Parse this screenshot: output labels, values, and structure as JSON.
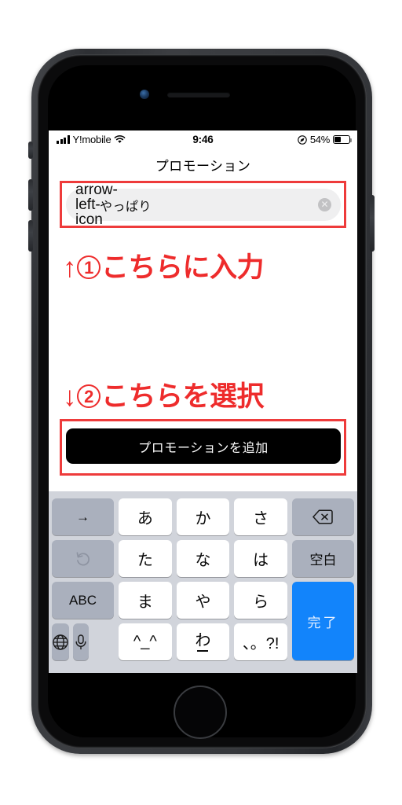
{
  "device": {
    "name": "iphone-se-black",
    "earpiece": "speaker-slot",
    "camera": "front-camera",
    "home_button": "home-button"
  },
  "status_bar": {
    "carrier": "Y!mobile",
    "signal_icon": "signal-bars-icon",
    "wifi_icon": "wifi-icon",
    "time": "9:46",
    "location_icon": "location-arrow-icon",
    "battery_percent": "54%",
    "battery_level": 54,
    "battery_icon": "battery-icon"
  },
  "nav": {
    "title": "プロモーション"
  },
  "search": {
    "back_icon": "arrow-left-icon",
    "value": "やっぱり",
    "clear_icon": "clear-circle-icon"
  },
  "annotations": [
    {
      "arrow": "↑",
      "number": "1",
      "text": "こちらに入力",
      "color": "#ee2c2c"
    },
    {
      "arrow": "↓",
      "number": "2",
      "text": "こちらを選択",
      "color": "#ee2c2c"
    }
  ],
  "cta": {
    "label": "プロモーションを追加",
    "background": "#000000",
    "text_color": "#ffffff"
  },
  "keyboard": {
    "type": "japanese-kana-12key",
    "background": "#d1d4db",
    "keys": {
      "arrow_right": "→",
      "undo": "↺",
      "abc": "ABC",
      "globe": "globe-icon",
      "mic": "microphone-icon",
      "a": "あ",
      "ka": "か",
      "sa": "さ",
      "ta": "た",
      "na": "な",
      "ha": "は",
      "ma": "ま",
      "ya": "や",
      "ra": "ら",
      "kaomoji": "^_^",
      "wa": "わ",
      "punct": "、。?!",
      "backspace": "delete-icon",
      "space": "空白",
      "done": "完了"
    },
    "done_key_color": "#1284fb"
  }
}
